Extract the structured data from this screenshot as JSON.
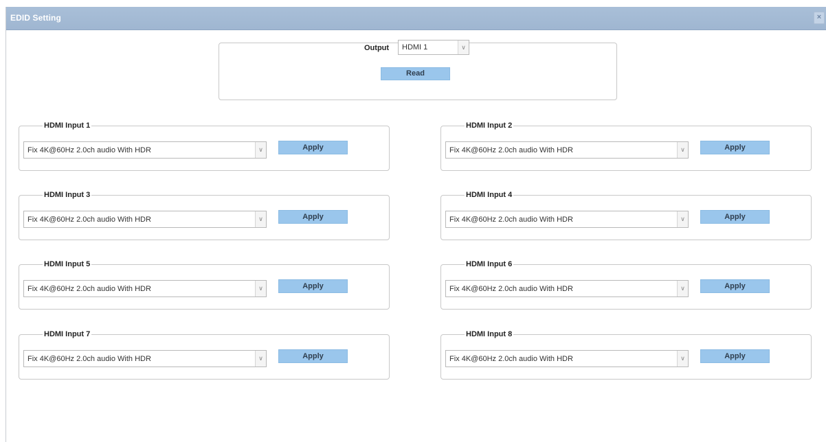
{
  "dialog": {
    "title": "EDID Setting",
    "close_glyph": "×"
  },
  "output": {
    "label": "Output",
    "selected": "HDMI 1",
    "read_label": "Read"
  },
  "inputs": [
    {
      "label": "HDMI Input 1",
      "selected": "Fix 4K@60Hz 2.0ch audio With HDR",
      "apply_label": "Apply"
    },
    {
      "label": "HDMI Input 2",
      "selected": "Fix 4K@60Hz 2.0ch audio With HDR",
      "apply_label": "Apply"
    },
    {
      "label": "HDMI Input 3",
      "selected": "Fix 4K@60Hz 2.0ch audio With HDR",
      "apply_label": "Apply"
    },
    {
      "label": "HDMI Input 4",
      "selected": "Fix 4K@60Hz 2.0ch audio With HDR",
      "apply_label": "Apply"
    },
    {
      "label": "HDMI Input 5",
      "selected": "Fix 4K@60Hz 2.0ch audio With HDR",
      "apply_label": "Apply"
    },
    {
      "label": "HDMI Input 6",
      "selected": "Fix 4K@60Hz 2.0ch audio With HDR",
      "apply_label": "Apply"
    },
    {
      "label": "HDMI Input 7",
      "selected": "Fix 4K@60Hz 2.0ch audio With HDR",
      "apply_label": "Apply"
    },
    {
      "label": "HDMI Input 8",
      "selected": "Fix 4K@60Hz 2.0ch audio With HDR",
      "apply_label": "Apply"
    }
  ],
  "icons": {
    "dropdown": "chevron-down-icon",
    "close": "close-icon"
  },
  "colors": {
    "titlebar": "#a9bfd8",
    "button": "#9ac6ec"
  }
}
